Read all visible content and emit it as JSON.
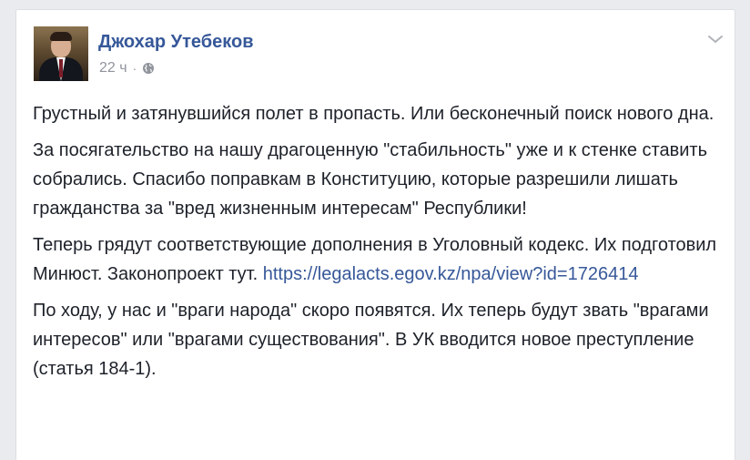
{
  "post": {
    "author": "Джохар Утебеков",
    "time": "22 ч",
    "separator": "·",
    "icons": {
      "privacy": "globe-icon",
      "menu": "chevron-down-icon"
    },
    "colors": {
      "link": "#365899",
      "text": "#1d2129",
      "meta": "#90949c",
      "background": "#e9ebee"
    },
    "paragraph1": "Грустный и затянувшийся полет в пропасть. Или бесконечный поиск нового дна.",
    "paragraph2": "За посягательство на нашу драгоценную \"стабильность\" уже и к стенке ставить собрались. Спасибо поправкам в Конституцию, которые разрешили лишать гражданства за \"вред жизненным интересам\" Республики!",
    "paragraph3_text": "Теперь грядут соответствующие дополнения в Уголовный кодекс. Их подготовил Минюст. Законопроект тут.",
    "paragraph3_link": "https://legalacts.egov.kz/npa/view?id=1726414",
    "paragraph4": "По ходу, у нас и \"враги народа\" скоро появятся. Их теперь будут звать \"врагами интересов\" или \"врагами существования\". В УК вводится новое преступление (статья 184-1)."
  }
}
